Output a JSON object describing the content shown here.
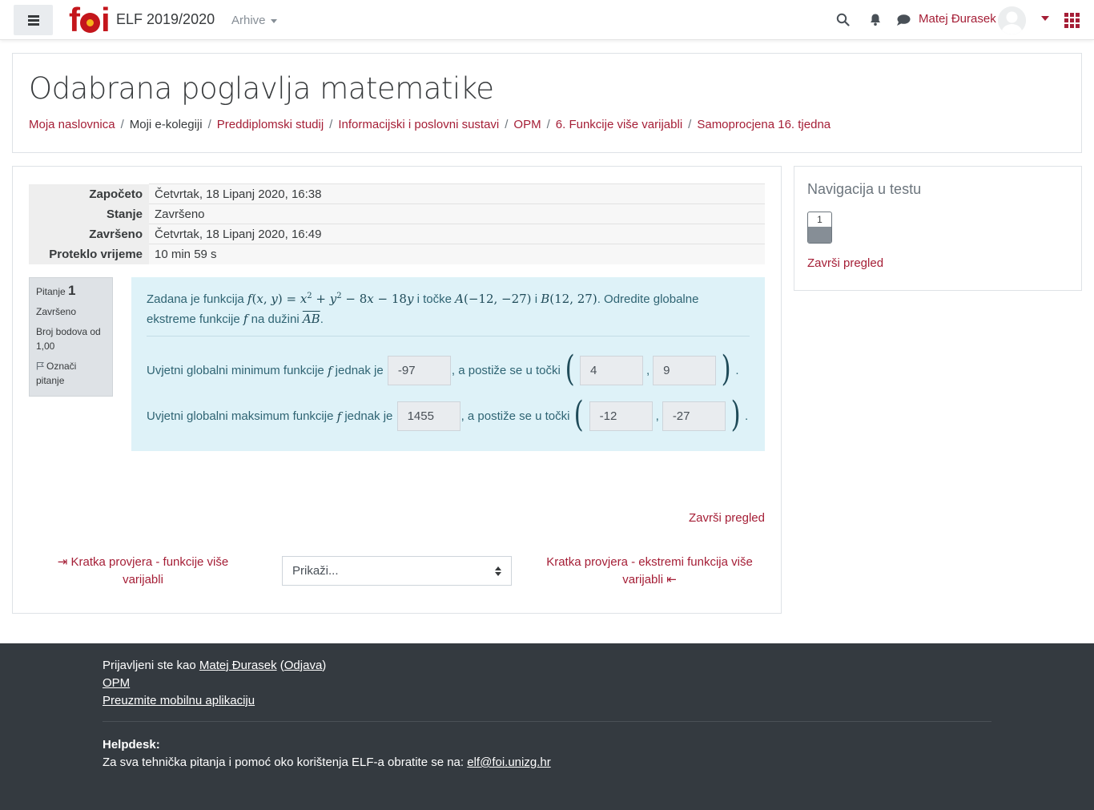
{
  "navbar": {
    "logo_text": "foi",
    "site_name": "ELF 2019/2020",
    "archive_label": "Arhive",
    "user_name": "Matej Đurasek",
    "icons": [
      "menu-icon",
      "search-icon",
      "bell-icon",
      "chat-icon",
      "user-menu-caret-icon",
      "apps-grid-icon"
    ]
  },
  "header": {
    "title": "Odabrana poglavlja matematike",
    "breadcrumb": [
      {
        "label": "Moja naslovnica",
        "link": true
      },
      {
        "label": "Moji e-kolegiji",
        "link": false
      },
      {
        "label": "Preddiplomski studij",
        "link": true
      },
      {
        "label": "Informacijski i poslovni sustavi",
        "link": true
      },
      {
        "label": "OPM",
        "link": true
      },
      {
        "label": "6. Funkcije više varijabli",
        "link": true
      },
      {
        "label": "Samoprocjena 16. tjedna",
        "link": true
      }
    ],
    "separator": "/"
  },
  "summary": [
    {
      "label": "Započeto",
      "value": "Četvrtak, 18 Lipanj 2020, 16:38"
    },
    {
      "label": "Stanje",
      "value": "Završeno"
    },
    {
      "label": "Završeno",
      "value": "Četvrtak, 18 Lipanj 2020, 16:49"
    },
    {
      "label": "Proteklo vrijeme",
      "value": "10 min 59 s"
    }
  ],
  "question_info": {
    "label": "Pitanje",
    "number": "1",
    "state": "Završeno",
    "marks": "Broj bodova od 1,00",
    "flag_label": "Označi pitanje"
  },
  "question": {
    "text_prefix": "Zadana je funkcija",
    "text_mid1": "i točke",
    "text_mid2": "i",
    "text_suffix": ". Odredite globalne",
    "text_line2_prefix": "ekstreme funkcije",
    "text_line2_mid": "na dužini",
    "text_line2_suffix": ".",
    "min_label": "Uvjetni globalni minimum funkcije",
    "max_label": "Uvjetni globalni maksimum funkcije",
    "equals_label": "jednak je",
    "at_point_label": ", a postiže se u točki",
    "comma": ",",
    "period": ".",
    "min_value": "-97",
    "min_point_x": "4",
    "min_point_y": "9",
    "max_value": "1455",
    "max_point_x": "-12",
    "max_point_y": "-27"
  },
  "actions": {
    "finish_review": "Završi pregled",
    "prev_link": "⇥ Kratka provjera - funkcije više varijabli",
    "next_link": "Kratka provjera - ekstremi funkcija više varijabli ⇤",
    "jump_select": "Prikaži..."
  },
  "quiz_nav": {
    "title": "Navigacija u testu",
    "buttons": [
      "1"
    ],
    "finish_review": "Završi pregled"
  },
  "footer": {
    "logged_in_as": "Prijavljeni ste kao",
    "user_name": "Matej Đurasek",
    "logout": "Odjava",
    "course_link": "OPM",
    "mobile_app": "Preuzmite mobilnu aplikaciju",
    "helpdesk_title": "Helpdesk:",
    "helpdesk_text": "Za sva tehnička pitanja i pomoć oko korištenja ELF-a obratite se na:",
    "helpdesk_email": "elf@foi.unizg.hr"
  },
  "colors": {
    "accent": "#a51e36",
    "question_bg": "#def2f8",
    "footer_bg": "#343a40"
  }
}
